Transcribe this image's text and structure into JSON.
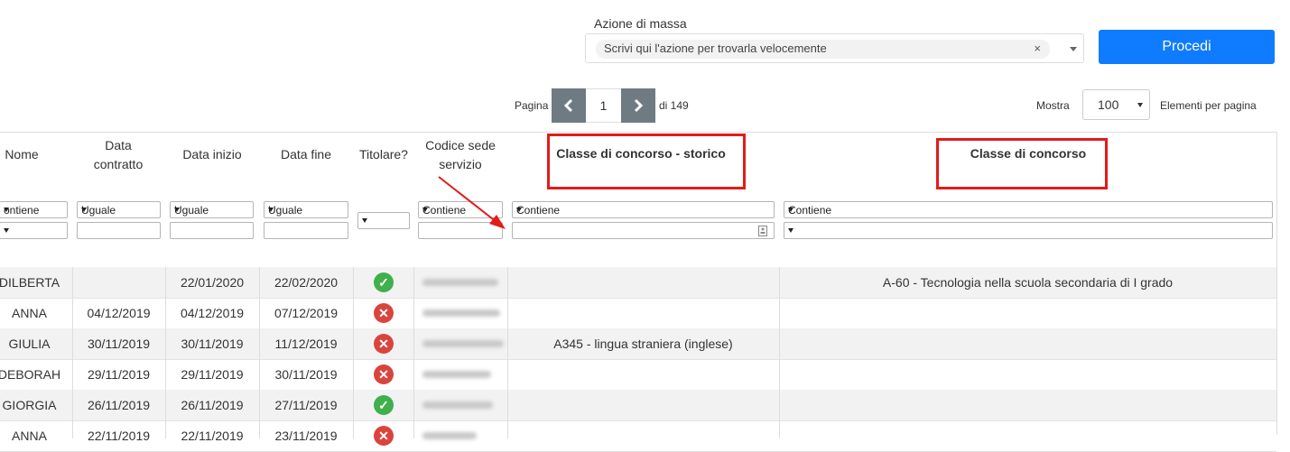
{
  "mass_action": {
    "label": "Azione di massa",
    "placeholder": "Scrivi qui l'azione per trovarla velocemente",
    "clear": "×",
    "proceed_label": "Procedi"
  },
  "pagination": {
    "page_label": "Pagina",
    "current_page": "1",
    "of_label": "di 149",
    "show_label": "Mostra",
    "page_size": "100",
    "per_page_label": "Elementi per pagina"
  },
  "columns": {
    "nome": "Nome",
    "data_contratto": "Data contratto",
    "data_inizio": "Data inizio",
    "data_fine": "Data fine",
    "titolare": "Titolare?",
    "codice_sede": "Codice sede servizio",
    "classe_storico": "Classe di concorso - storico",
    "classe": "Classe di concorso"
  },
  "filters": {
    "contains": "Contiene",
    "contains_cut": "ontiene",
    "equal": "Uguale"
  },
  "rows": [
    {
      "nome": "DILBERTA",
      "data_contratto": "",
      "data_inizio": "22/01/2020",
      "data_fine": "22/02/2020",
      "titolare": "yes",
      "classe_storico": "",
      "classe": "A-60 - Tecnologia nella scuola secondaria di I grado"
    },
    {
      "nome": "ANNA",
      "data_contratto": "04/12/2019",
      "data_inizio": "04/12/2019",
      "data_fine": "07/12/2019",
      "titolare": "no",
      "classe_storico": "",
      "classe": ""
    },
    {
      "nome": "GIULIA",
      "data_contratto": "30/11/2019",
      "data_inizio": "30/11/2019",
      "data_fine": "11/12/2019",
      "titolare": "no",
      "classe_storico": "A345 - lingua straniera (inglese)",
      "classe": ""
    },
    {
      "nome": "DEBORAH",
      "data_contratto": "29/11/2019",
      "data_inizio": "29/11/2019",
      "data_fine": "30/11/2019",
      "titolare": "no",
      "classe_storico": "",
      "classe": ""
    },
    {
      "nome": "GIORGIA",
      "data_contratto": "26/11/2019",
      "data_inizio": "26/11/2019",
      "data_fine": "27/11/2019",
      "titolare": "yes",
      "classe_storico": "",
      "classe": ""
    },
    {
      "nome": "ANNA",
      "data_contratto": "22/11/2019",
      "data_inizio": "22/11/2019",
      "data_fine": "23/11/2019",
      "titolare": "no",
      "classe_storico": "",
      "classe": ""
    }
  ],
  "colors": {
    "accent": "#0f7cff",
    "highlight": "#e21b1b",
    "ok": "#3fb04c",
    "ko": "#d9453d"
  }
}
